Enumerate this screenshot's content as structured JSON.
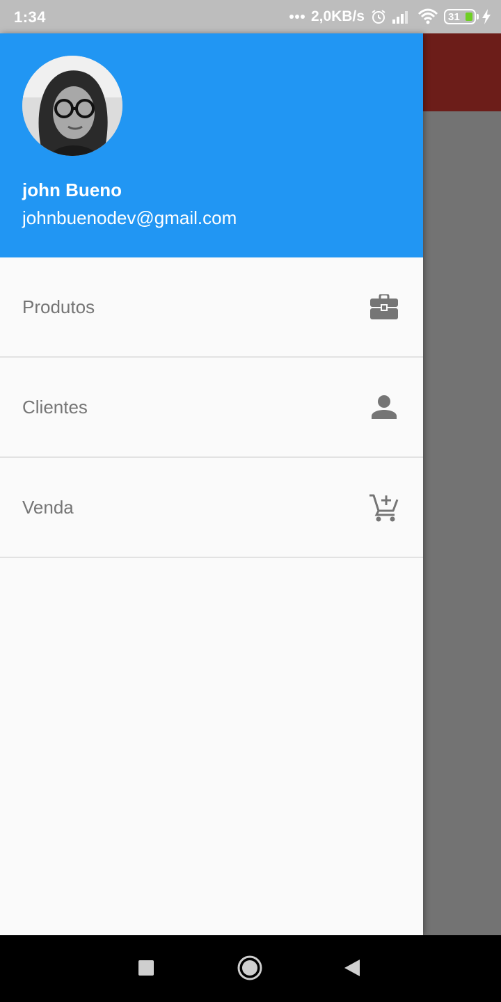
{
  "status_bar": {
    "time": "1:34",
    "network_speed": "2,0KB/s",
    "battery_level": "31",
    "icons": [
      "dots-icon",
      "alarm-icon",
      "signal-icon",
      "wifi-icon",
      "battery-icon",
      "charging-icon"
    ]
  },
  "drawer": {
    "header": {
      "account_name": "john Bueno",
      "account_email": "johnbuenodev@gmail.com",
      "header_color": "#2196f3"
    },
    "items": [
      {
        "label": "Produtos",
        "icon": "briefcase-icon"
      },
      {
        "label": "Clientes",
        "icon": "person-icon"
      },
      {
        "label": "Venda",
        "icon": "add-shopping-cart-icon"
      }
    ]
  },
  "background_app": {
    "appbar_color": "#6c1d19",
    "scrim_color": "#737373"
  },
  "nav_bar": {
    "buttons": [
      "recents-button",
      "home-button",
      "back-button"
    ]
  }
}
